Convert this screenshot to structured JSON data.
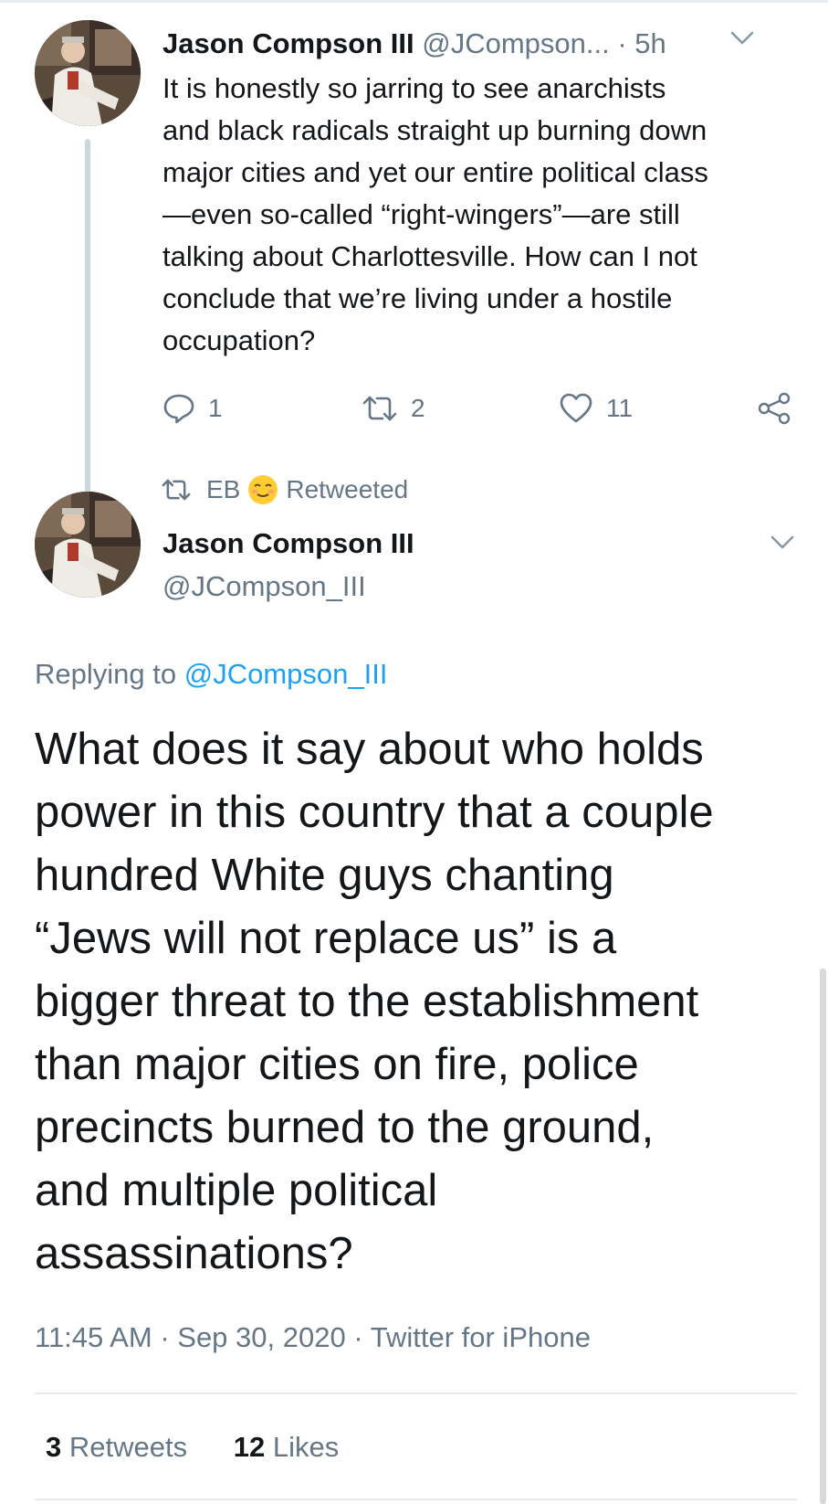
{
  "parent_tweet": {
    "name": "Jason Compson III",
    "handle": "@JCompson...",
    "separator": "·",
    "time": "5h",
    "lines": [
      "It is honestly so jarring to see anarchists",
      "and black radicals straight up burning down",
      "major cities and yet our entire political class",
      "—even so-called “right-wingers”—are still",
      "talking about Charlottesville. How can I not",
      "conclude that we’re living under a hostile",
      "occupation?"
    ],
    "reply_count": "1",
    "retweet_count": "2",
    "like_count": "11",
    "icons": [
      "reply-icon",
      "retweet-icon",
      "like-icon",
      "share-icon",
      "chevron-down-icon"
    ]
  },
  "retweeted_by": {
    "name": "EB",
    "emoji": "relieved-face-emoji",
    "label": "Retweeted"
  },
  "main_tweet": {
    "name": "Jason Compson III",
    "handle": "@JCompson_III",
    "replying_prefix": "Replying to",
    "replying_to": "@JCompson_III",
    "lines": [
      "What does it say about who holds",
      "power in this country that a couple",
      "hundred White guys chanting",
      "“Jews will not replace us” is a",
      "bigger threat to the establishment",
      "than major cities on fire, police",
      "precincts burned to the ground,",
      "and multiple political",
      "assassinations?"
    ],
    "time": "11:45 AM",
    "separator": "·",
    "date": "Sep 30, 2020",
    "source": "Twitter for iPhone",
    "retweets_count": "3",
    "retweets_label": "Retweets",
    "likes_count": "12",
    "likes_label": "Likes"
  },
  "colors": {
    "text": "#14171a",
    "secondary": "#657786",
    "link": "#1da1f2",
    "divider": "#e6ecf0",
    "thread_line": "#ccd6dd"
  }
}
